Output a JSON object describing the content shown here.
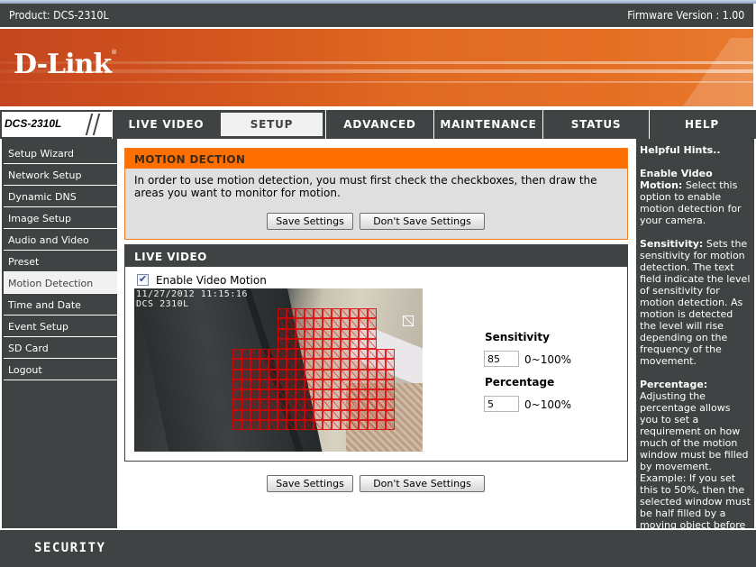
{
  "header": {
    "product": "Product: DCS-2310L",
    "firmware": "Firmware Version : 1.00",
    "logo": "D-Link",
    "logo_mark": "®"
  },
  "nav": {
    "model": "DCS-2310L",
    "tabs": [
      {
        "label": "LIVE VIDEO",
        "active": false
      },
      {
        "label": "SETUP",
        "active": true
      },
      {
        "label": "ADVANCED",
        "active": false
      },
      {
        "label": "MAINTENANCE",
        "active": false
      },
      {
        "label": "STATUS",
        "active": false
      },
      {
        "label": "HELP",
        "active": false
      }
    ]
  },
  "sidebar": {
    "items": [
      {
        "label": "Setup Wizard"
      },
      {
        "label": "Network Setup"
      },
      {
        "label": "Dynamic DNS"
      },
      {
        "label": "Image Setup"
      },
      {
        "label": "Audio and Video"
      },
      {
        "label": "Preset"
      },
      {
        "label": "Motion Detection",
        "active": true
      },
      {
        "label": "Time and Date"
      },
      {
        "label": "Event Setup"
      },
      {
        "label": "SD Card"
      },
      {
        "label": "Logout"
      }
    ]
  },
  "motion_section": {
    "title": "MOTION DECTION",
    "description": "In order to use motion detection, you must first check the checkboxes, then draw the areas you want to monitor for motion.",
    "save_label": "Save Settings",
    "dont_save_label": "Don't Save Settings"
  },
  "live_video": {
    "title": "LIVE VIDEO",
    "enable_label": "Enable Video Motion",
    "enable_checked": true,
    "osd_timestamp": "11/27/2012 11:15:16",
    "osd_camera": "DCS 2310L",
    "sensitivity_label": "Sensitivity",
    "sensitivity_value": "85",
    "sensitivity_range": "0~100%",
    "percentage_label": "Percentage",
    "percentage_value": "5",
    "percentage_range": "0~100%",
    "motion_regions": [
      {
        "col_start": 16,
        "row_start": 2,
        "cols": 11,
        "rows": 4
      },
      {
        "col_start": 11,
        "row_start": 6,
        "cols": 18,
        "rows": 8
      }
    ]
  },
  "bottom_buttons": {
    "save_label": "Save Settings",
    "dont_save_label": "Don't Save Settings"
  },
  "hints": {
    "title": "Helpful Hints..",
    "items": [
      {
        "term": "Enable Video Motion:",
        "text": " Select this option to enable motion detection for your camera."
      },
      {
        "term": "Sensitivity:",
        "text": " Sets the sensitivity for motion detection. The text field indicate the level of sensitivity for motion detection. As motion is detected the level will rise depending on the frequency of the movement."
      },
      {
        "term": "Percentage:",
        "text": " Adjusting the percentage allows you to set a requirement on how much of the motion window must be filled by movement. Example: If you set this to 50%, then the selected window must be half filled by a moving object before it triggers motion detection."
      }
    ]
  },
  "footer": {
    "label": "SECURITY"
  }
}
